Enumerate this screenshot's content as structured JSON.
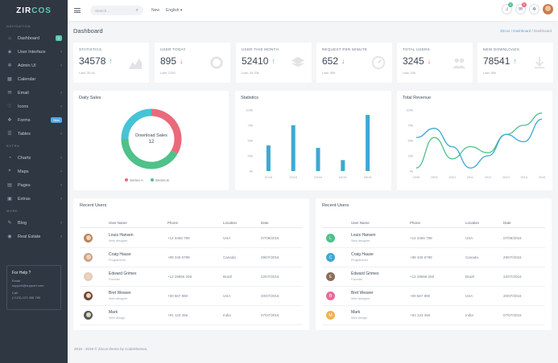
{
  "brand": {
    "main": "ZIR",
    "accent": "COS"
  },
  "sidebar": {
    "section_nav": "Navigation",
    "section_extra": "Extra",
    "section_more": "More",
    "items": [
      {
        "label": "Dashboard",
        "icon": "home-icon",
        "badge": "2"
      },
      {
        "label": "User Interface",
        "icon": "layers-icon"
      },
      {
        "label": "Admin UI",
        "icon": "settings-icon"
      },
      {
        "label": "Calendar",
        "icon": "calendar-icon"
      },
      {
        "label": "Email",
        "icon": "mail-icon"
      },
      {
        "label": "Icons",
        "icon": "heart-icon"
      },
      {
        "label": "Forms",
        "icon": "forms-icon",
        "badge": "New"
      },
      {
        "label": "Tables",
        "icon": "list-icon"
      },
      {
        "label": "Charts",
        "icon": "chart-icon"
      },
      {
        "label": "Maps",
        "icon": "map-icon"
      },
      {
        "label": "Pages",
        "icon": "page-icon"
      },
      {
        "label": "Extras",
        "icon": "box-icon"
      },
      {
        "label": "Blog",
        "icon": "blog-icon"
      },
      {
        "label": "Real Estate",
        "icon": "location-icon"
      }
    ],
    "help": {
      "title": "For Help ?",
      "email_label": "Email",
      "email": "support@support.com",
      "call_label": "Call",
      "phone": "(+123) 123 456 789"
    }
  },
  "topbar": {
    "search_placeholder": "Search...",
    "new_label": "New",
    "language": "English",
    "notif_count_1": "3",
    "notif_count_2": "9"
  },
  "page": {
    "title": "Dashboard",
    "breadcrumb": [
      "Zircos",
      "Dashboard",
      "Dashboard"
    ]
  },
  "stats": [
    {
      "label": "Statistics",
      "value": "34578",
      "dir": "up",
      "sub": "Last: 30.4k"
    },
    {
      "label": "User Today",
      "value": "895",
      "dir": "down",
      "sub": "Last: 1250"
    },
    {
      "label": "User This Month",
      "value": "52410",
      "dir": "up",
      "sub": "Last: 40.33k"
    },
    {
      "label": "Request Per Minute",
      "value": "652",
      "dir": "down",
      "sub": "Last: 956"
    },
    {
      "label": "Total Users",
      "value": "3245",
      "dir": "down",
      "sub": "Last: 20k"
    },
    {
      "label": "New Downloads",
      "value": "78541",
      "dir": "up",
      "sub": "Last: 50k"
    }
  ],
  "charts": {
    "daily_sales_title": "Daily Sales",
    "statistics_title": "Statistics",
    "revenue_title": "Total Revenue",
    "donut_center_label": "Download Sales",
    "donut_center_value": "12"
  },
  "chart_data": [
    {
      "type": "pie",
      "title": "Daily Sales",
      "series": [
        {
          "name": "Series A",
          "value": 4,
          "color": "#e96a7b"
        },
        {
          "name": "Series B",
          "value": 5,
          "color": "#4fc18a"
        },
        {
          "name": "",
          "value": 3,
          "color": "#47c3d6"
        }
      ]
    },
    {
      "type": "bar",
      "title": "Statistics",
      "categories": [
        "01/16",
        "02/16",
        "03/16",
        "04/16",
        "05/16"
      ],
      "ytick_labels": [
        "100k",
        "75k",
        "50k",
        "25k",
        "0k"
      ],
      "values": [
        42,
        75,
        38,
        18,
        92
      ],
      "ylim": [
        0,
        100
      ],
      "color": "#3ea8d3"
    },
    {
      "type": "line",
      "title": "Total Revenue",
      "x": [
        "2008",
        "2009",
        "2010",
        "2011",
        "2012",
        "2013",
        "2014",
        "2015"
      ],
      "ytick_labels": [
        "100k",
        "75k",
        "50k",
        "25k",
        "0k"
      ],
      "ylim": [
        0,
        100
      ],
      "series": [
        {
          "name": "",
          "color": "#4fc18a",
          "values": [
            5,
            55,
            20,
            40,
            30,
            60,
            75,
            95
          ]
        },
        {
          "name": "",
          "color": "#3ea8d3",
          "values": [
            55,
            70,
            40,
            5,
            25,
            60,
            48,
            85
          ]
        }
      ]
    }
  ],
  "tables": {
    "title": "Recent Users",
    "headers": [
      "User Name",
      "Phone",
      "Location",
      "Date"
    ],
    "rows": [
      {
        "name": "Louis Hansen",
        "role": "Web designer",
        "phone": "+12 3456 789",
        "location": "USA",
        "date": "07/08/2016"
      },
      {
        "name": "Craig Hause",
        "role": "Programmer",
        "phone": "+89 345 6789",
        "location": "Canada",
        "date": "29/07/2016"
      },
      {
        "name": "Edward Grimes",
        "role": "Founder",
        "phone": "+12 29856 256",
        "location": "Brazil",
        "date": "22/07/2016"
      },
      {
        "name": "Bret Weaver",
        "role": "Web designer",
        "phone": "+00 567 890",
        "location": "USA",
        "date": "20/07/2016"
      },
      {
        "name": "Mark",
        "role": "Web design",
        "phone": "+91 123 456",
        "location": "India",
        "date": "07/07/2016"
      }
    ],
    "avatars_left": [
      {
        "kind": "photo",
        "color": "#b9855b"
      },
      {
        "kind": "photo",
        "color": "#c9a58c"
      },
      {
        "kind": "photo",
        "color": "#e2ccc1"
      },
      {
        "kind": "photo",
        "color": "#6b4a3d"
      },
      {
        "kind": "photo",
        "color": "#4b5c5a"
      }
    ],
    "avatars_right": [
      {
        "letter": "L",
        "color": "#4fc18a"
      },
      {
        "letter": "C",
        "color": "#3ea8d3"
      },
      {
        "letter": "E",
        "color": "#8c6b5a"
      },
      {
        "letter": "B",
        "color": "#e96a9a"
      },
      {
        "letter": "M",
        "color": "#f3b24a"
      }
    ]
  },
  "footer": "2016 - 2019 © Zircos theme by Coderthemes."
}
